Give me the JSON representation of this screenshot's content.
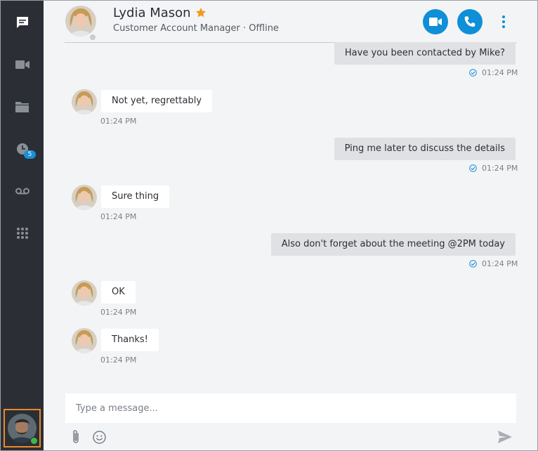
{
  "sidebar": {
    "items": [
      {
        "icon": "chat-icon",
        "label": "Chats",
        "active": true
      },
      {
        "icon": "video-icon",
        "label": "Video"
      },
      {
        "icon": "folder-icon",
        "label": "Files"
      },
      {
        "icon": "clock-icon",
        "label": "Recent",
        "badge": "5"
      },
      {
        "icon": "voicemail-icon",
        "label": "Voicemail"
      },
      {
        "icon": "dialpad-icon",
        "label": "Dialpad"
      }
    ],
    "user_status_color": "#3dbb4a",
    "accent": "#e88a2c"
  },
  "contact": {
    "name": "Lydia Mason",
    "subtitle": "Customer Account Manager · Offline",
    "favorite": true
  },
  "actions": {
    "video_call": "video-call-icon",
    "voice_call": "phone-icon",
    "more": "more-vertical-icon",
    "color": "#0e8fd8"
  },
  "messages": [
    {
      "direction": "out",
      "text": "Have you been contacted by Mike?",
      "time": "01:24 PM",
      "status": "read"
    },
    {
      "direction": "in",
      "text": "Not yet, regrettably",
      "time": "01:24 PM"
    },
    {
      "direction": "out",
      "text": "Ping me later to discuss the details",
      "time": "01:24 PM",
      "status": "read"
    },
    {
      "direction": "in",
      "text": "Sure thing",
      "time": "01:24 PM"
    },
    {
      "direction": "out",
      "text": "Also don't forget about the meeting @2PM today",
      "time": "01:24 PM",
      "status": "read"
    },
    {
      "direction": "in",
      "text": "OK",
      "time": "01:24 PM"
    },
    {
      "direction": "in",
      "text": "Thanks!",
      "time": "01:24 PM"
    }
  ],
  "composer": {
    "placeholder": "Type a message...",
    "attach": "paperclip-icon",
    "emoji": "emoji-icon",
    "send": "send-icon"
  }
}
